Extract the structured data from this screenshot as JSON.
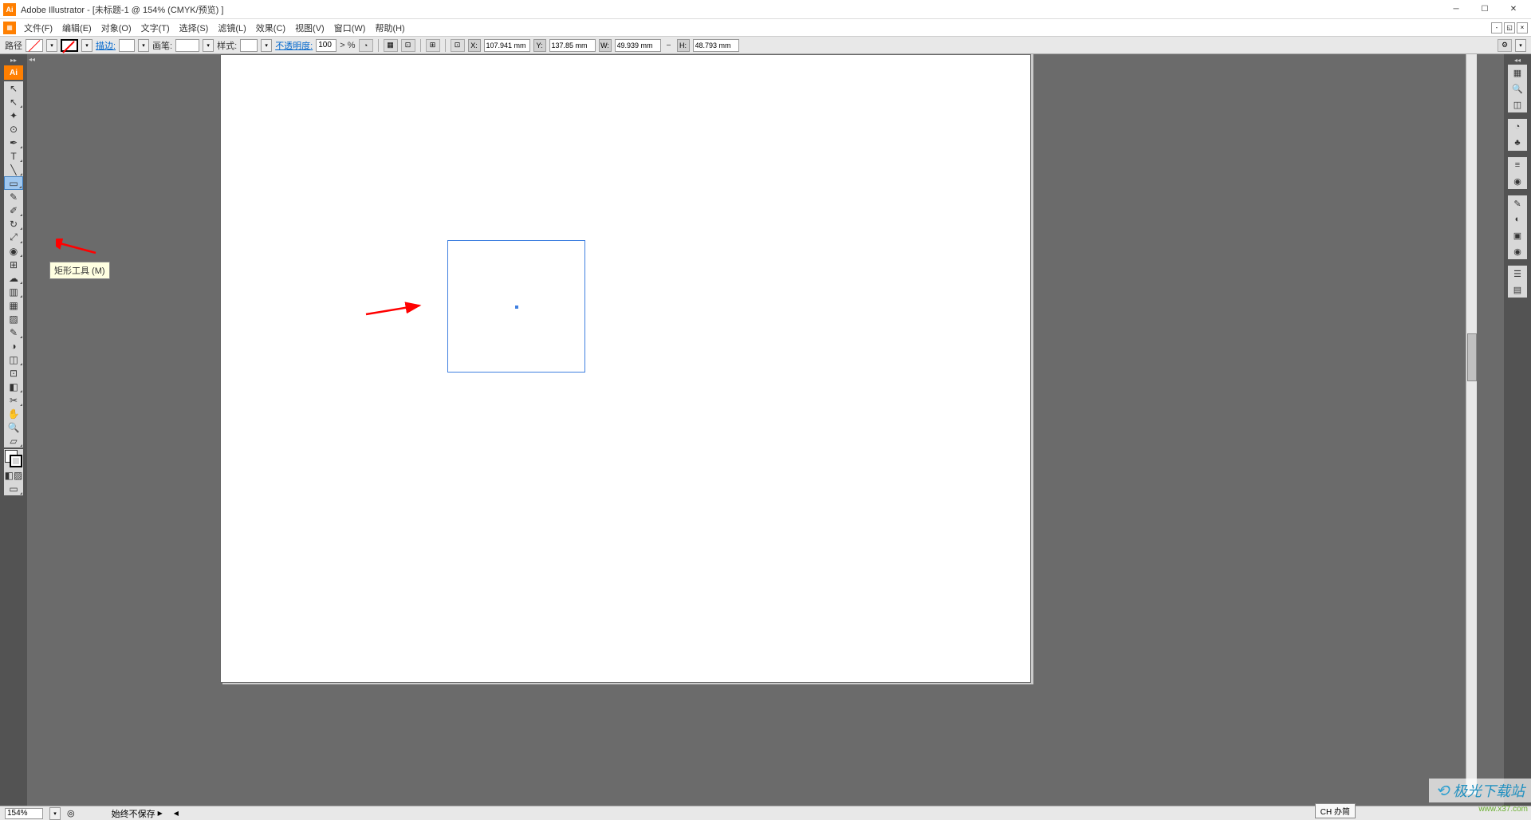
{
  "title": "Adobe Illustrator - [未标题-1 @ 154% (CMYK/预览) ]",
  "menu": {
    "file": "文件(F)",
    "edit": "编辑(E)",
    "object": "对象(O)",
    "type": "文字(T)",
    "select": "选择(S)",
    "filter": "滤镜(L)",
    "effect": "效果(C)",
    "view": "视图(V)",
    "window": "窗口(W)",
    "help": "帮助(H)"
  },
  "controlbar": {
    "path": "路径",
    "stroke": "描边:",
    "brush": "画笔:",
    "style": "样式:",
    "opacity": "不透明度:",
    "opacity_value": "100",
    "opacity_unit": "> %",
    "x_label": "X:",
    "x_value": "107.941 mm",
    "y_label": "Y:",
    "y_value": "137.85 mm",
    "w_label": "W:",
    "w_value": "49.939 mm",
    "h_label": "H:",
    "h_value": "48.793 mm"
  },
  "tooltip": "矩形工具 (M)",
  "status": {
    "zoom": "154%",
    "save_state": "始终不保存"
  },
  "ime": "CH 办简",
  "watermark": {
    "main": "极光下载站",
    "sub": "www.x37.com"
  },
  "tools": [
    {
      "name": "selection-tool",
      "glyph": "↖",
      "corner": false
    },
    {
      "name": "direct-selection-tool",
      "glyph": "↖",
      "corner": true
    },
    {
      "name": "magic-wand-tool",
      "glyph": "✦",
      "corner": false
    },
    {
      "name": "lasso-tool",
      "glyph": "⊙",
      "corner": false
    },
    {
      "name": "pen-tool",
      "glyph": "✒",
      "corner": true
    },
    {
      "name": "type-tool",
      "glyph": "T",
      "corner": true
    },
    {
      "name": "line-tool",
      "glyph": "╲",
      "corner": true
    },
    {
      "name": "rectangle-tool",
      "glyph": "▭",
      "corner": true,
      "selected": true
    },
    {
      "name": "paintbrush-tool",
      "glyph": "✎",
      "corner": false
    },
    {
      "name": "pencil-tool",
      "glyph": "✐",
      "corner": true
    },
    {
      "name": "rotate-tool",
      "glyph": "↻",
      "corner": true
    },
    {
      "name": "scale-tool",
      "glyph": "⤢",
      "corner": true
    },
    {
      "name": "warp-tool",
      "glyph": "◉",
      "corner": true
    },
    {
      "name": "free-transform-tool",
      "glyph": "⊞",
      "corner": false
    },
    {
      "name": "symbol-sprayer-tool",
      "glyph": "☁",
      "corner": true
    },
    {
      "name": "column-graph-tool",
      "glyph": "▥",
      "corner": true
    },
    {
      "name": "mesh-tool",
      "glyph": "▦",
      "corner": false
    },
    {
      "name": "gradient-tool",
      "glyph": "▨",
      "corner": false
    },
    {
      "name": "eyedropper-tool",
      "glyph": "✎",
      "corner": true
    },
    {
      "name": "blend-tool",
      "glyph": "◑",
      "corner": false
    },
    {
      "name": "live-paint-tool",
      "glyph": "◫",
      "corner": true
    },
    {
      "name": "crop-area-tool",
      "glyph": "⊡",
      "corner": false
    },
    {
      "name": "eraser-tool",
      "glyph": "◧",
      "corner": true
    },
    {
      "name": "scissors-tool",
      "glyph": "✂",
      "corner": true
    },
    {
      "name": "hand-tool",
      "glyph": "✋",
      "corner": false
    },
    {
      "name": "zoom-tool",
      "glyph": "🔍",
      "corner": false
    },
    {
      "name": "slice-tool",
      "glyph": "▱",
      "corner": true
    }
  ],
  "panels": [
    {
      "name": "panel-tools",
      "glyph": "▦"
    },
    {
      "name": "panel-navigator",
      "glyph": "🔍"
    },
    {
      "name": "panel-info",
      "glyph": "◫"
    },
    {
      "name": "panel-color",
      "glyph": "◔"
    },
    {
      "name": "panel-swatches",
      "glyph": "♣"
    },
    {
      "name": "panel-stroke",
      "glyph": "≡"
    },
    {
      "name": "panel-symbols",
      "glyph": "◉"
    },
    {
      "name": "panel-brushes",
      "glyph": "✎"
    },
    {
      "name": "panel-graphic-styles",
      "glyph": "◐"
    },
    {
      "name": "panel-transparency",
      "glyph": "▣"
    },
    {
      "name": "panel-appearance",
      "glyph": "◉"
    },
    {
      "name": "panel-align",
      "glyph": "☰"
    },
    {
      "name": "panel-layers",
      "glyph": "▤"
    }
  ]
}
